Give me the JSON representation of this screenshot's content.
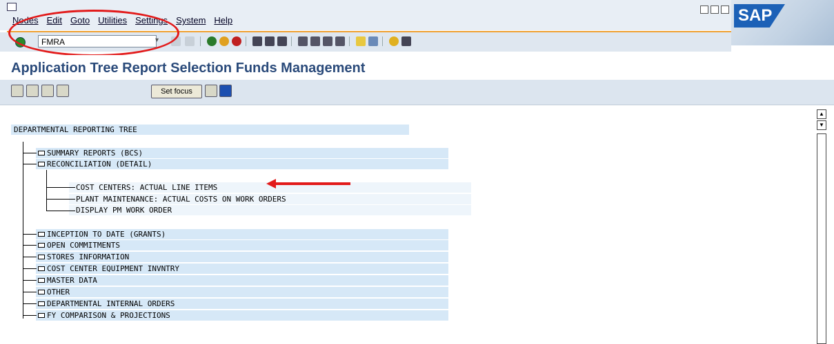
{
  "menu": {
    "items": [
      "Nodes",
      "Edit",
      "Goto",
      "Utilities",
      "Settings",
      "System",
      "Help"
    ]
  },
  "toolbar": {
    "command_value": "FMRA"
  },
  "sap_logo_text": "SAP",
  "page_title": "Application Tree Report Selection Funds Management",
  "app_toolbar": {
    "set_focus_label": "Set focus"
  },
  "tree": {
    "root": "DEPARTMENTAL REPORTING TREE",
    "nodes": [
      "SUMMARY REPORTS (BCS)",
      "RECONCILIATION (DETAIL)"
    ],
    "children": [
      "COST CENTERS: ACTUAL LINE ITEMS",
      "PLANT MAINTENANCE: ACTUAL COSTS ON WORK ORDERS",
      "DISPLAY PM WORK ORDER"
    ],
    "more_nodes": [
      "INCEPTION TO DATE (GRANTS)",
      "OPEN COMMITMENTS",
      "STORES INFORMATION",
      "COST CENTER EQUIPMENT INVNTRY",
      "MASTER DATA",
      "OTHER",
      "DEPARTMENTAL INTERNAL ORDERS",
      "FY COMPARISON & PROJECTIONS"
    ]
  },
  "colors": {
    "annotation_red": "#e21a1a",
    "highlight_blue": "#d6e8f7",
    "title_blue": "#2a4a7a"
  }
}
